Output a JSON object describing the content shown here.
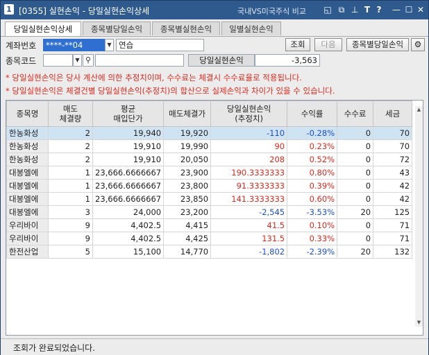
{
  "window": {
    "number": "1",
    "title": "[0355] 실현손익 - 당일실현손익상세",
    "compare_label": "국내VS미국주식 비교",
    "icons": [
      "window-icon",
      "restore-icon",
      "pin-icon",
      "font-size-icon",
      "help-icon",
      "minimize-icon",
      "maximize-icon",
      "close-icon"
    ],
    "icon_glyphs": [
      "◱",
      "⧉",
      "⊥",
      "T",
      "?",
      "—",
      "☐",
      "✕"
    ]
  },
  "tabs": [
    {
      "label": "당일실현손익상세",
      "active": true
    },
    {
      "label": "종목별당일손익",
      "active": false
    },
    {
      "label": "종목별실현손익",
      "active": false
    },
    {
      "label": "일별실현손익",
      "active": false
    }
  ],
  "form": {
    "account_label": "계좌번호",
    "account_value": "****-**04",
    "account_name": "연습",
    "query_button": "조회",
    "next_button": "다음",
    "by_stock_button": "종목별당일손익",
    "stock_code_label": "종목코드",
    "stock_code_value": "",
    "stock_name_value": "",
    "daily_pnl_label": "당일실현손익",
    "daily_pnl_value": "-3,563"
  },
  "notes": [
    "* 당일실현손익은 당사 계산에 의한 추정치이며, 수수료는 체결시 수수료율로 적용됩니다.",
    "* 당일실현손익은 체결건별 당일실현손익(추정치)의 합산으로 실제손익과 차이가 있을 수 있습니다."
  ],
  "table": {
    "headers": [
      {
        "line1": "종목명",
        "line2": ""
      },
      {
        "line1": "매도",
        "line2": "체결량"
      },
      {
        "line1": "평균",
        "line2": "매입단가"
      },
      {
        "line1": "매도체결가",
        "line2": ""
      },
      {
        "line1": "당일실현손익",
        "line2": "(추정치)"
      },
      {
        "line1": "수익률",
        "line2": ""
      },
      {
        "line1": "수수료",
        "line2": ""
      },
      {
        "line1": "세금",
        "line2": ""
      }
    ],
    "rows": [
      {
        "name": "한농화성",
        "qty": "2",
        "avg": "19,940",
        "sell": "19,920",
        "pnl": "-110",
        "rate": "-0.28%",
        "fee": "0",
        "tax": "70",
        "sign": "neg",
        "selected": true
      },
      {
        "name": "한농화성",
        "qty": "2",
        "avg": "19,910",
        "sell": "19,990",
        "pnl": "90",
        "rate": "0.23%",
        "fee": "0",
        "tax": "70",
        "sign": "pos",
        "selected": false
      },
      {
        "name": "한농화성",
        "qty": "2",
        "avg": "19,910",
        "sell": "20,050",
        "pnl": "208",
        "rate": "0.52%",
        "fee": "0",
        "tax": "72",
        "sign": "pos",
        "selected": false
      },
      {
        "name": "대봉엘에",
        "qty": "1",
        "avg": "23,666.6666667",
        "sell": "23,900",
        "pnl": "190.3333333",
        "rate": "0.80%",
        "fee": "0",
        "tax": "43",
        "sign": "pos",
        "selected": false
      },
      {
        "name": "대봉엘에",
        "qty": "1",
        "avg": "23,666.6666667",
        "sell": "23,800",
        "pnl": "91.3333333",
        "rate": "0.39%",
        "fee": "0",
        "tax": "42",
        "sign": "pos",
        "selected": false
      },
      {
        "name": "대봉엘에",
        "qty": "1",
        "avg": "23,666.6666667",
        "sell": "23,850",
        "pnl": "141.3333333",
        "rate": "0.60%",
        "fee": "0",
        "tax": "42",
        "sign": "pos",
        "selected": false
      },
      {
        "name": "대봉엘에",
        "qty": "3",
        "avg": "24,000",
        "sell": "23,200",
        "pnl": "-2,545",
        "rate": "-3.53%",
        "fee": "20",
        "tax": "125",
        "sign": "neg",
        "selected": false
      },
      {
        "name": "우리바이",
        "qty": "9",
        "avg": "4,402.5",
        "sell": "4,415",
        "pnl": "41.5",
        "rate": "0.10%",
        "fee": "0",
        "tax": "71",
        "sign": "pos",
        "selected": false
      },
      {
        "name": "우리바이",
        "qty": "9",
        "avg": "4,402.5",
        "sell": "4,425",
        "pnl": "131.5",
        "rate": "0.33%",
        "fee": "0",
        "tax": "71",
        "sign": "pos",
        "selected": false
      },
      {
        "name": "한전산업",
        "qty": "5",
        "avg": "15,100",
        "sell": "14,770",
        "pnl": "-1,802",
        "rate": "-2.39%",
        "fee": "20",
        "tax": "132",
        "sign": "neg",
        "selected": false
      }
    ]
  },
  "status": {
    "text": "조회가 완료되었습니다."
  }
}
